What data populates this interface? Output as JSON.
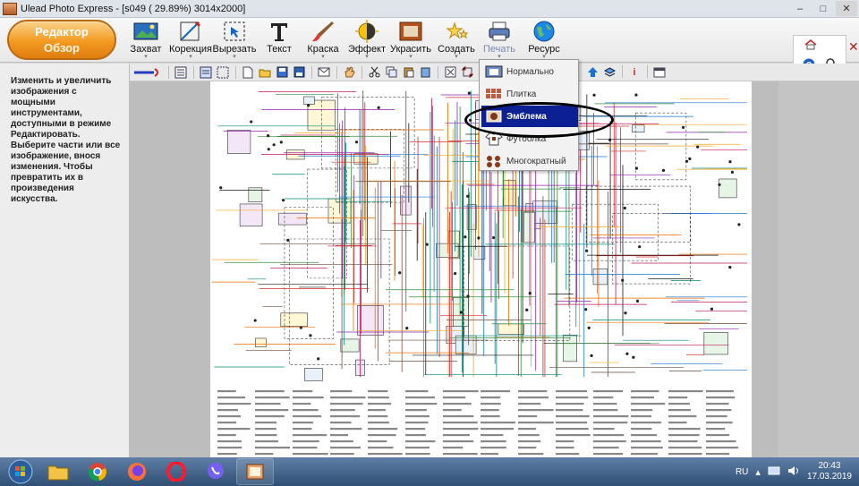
{
  "window": {
    "title": "Ulead Photo Express - [s049 ( 29.89%) 3014x2000]",
    "minimize": "–",
    "maximize": "□",
    "close": "✕"
  },
  "mode": {
    "line1": "Редактор",
    "line2": "Обзор"
  },
  "ribbon": [
    {
      "id": "capture",
      "label": "Захват",
      "icon": "picture-icon"
    },
    {
      "id": "correction",
      "label": "Корекция",
      "icon": "correction-icon"
    },
    {
      "id": "cut",
      "label": "Вырезать",
      "icon": "selection-icon"
    },
    {
      "id": "text",
      "label": "Текст",
      "icon": "text-t-icon"
    },
    {
      "id": "paint",
      "label": "Краска",
      "icon": "brush-icon"
    },
    {
      "id": "effect",
      "label": "Эффект",
      "icon": "effect-icon"
    },
    {
      "id": "decorate",
      "label": "Украсить",
      "icon": "frame-icon"
    },
    {
      "id": "create",
      "label": "Создать",
      "icon": "stars-icon"
    },
    {
      "id": "print",
      "label": "Печать",
      "icon": "printer-icon"
    },
    {
      "id": "resources",
      "label": "Ресурс",
      "icon": "globe-icon"
    }
  ],
  "left_panel": {
    "description": "Изменить и увеличить изображения с мощными инструментами, доступными в режиме Редактировать. Выберите части или все изображение, внося изменения. Чтобы превратить их в произведения искусства."
  },
  "print_menu": {
    "items": [
      {
        "label": "Нормально",
        "icon": "normal-print-icon"
      },
      {
        "label": "Плитка",
        "icon": "tile-icon"
      },
      {
        "label": "Эмблема",
        "icon": "emblem-icon",
        "selected": true
      },
      {
        "label": "Футболка",
        "icon": "tshirt-icon"
      },
      {
        "label": "Многократный",
        "icon": "multiple-icon"
      }
    ]
  },
  "taskbar": {
    "language": "RU",
    "time": "20:43",
    "date": "17.03.2019"
  },
  "colors": {
    "accent_orange": "#f29a21",
    "menu_selection": "#0c1f93",
    "taskbar": "#2f4f75"
  }
}
